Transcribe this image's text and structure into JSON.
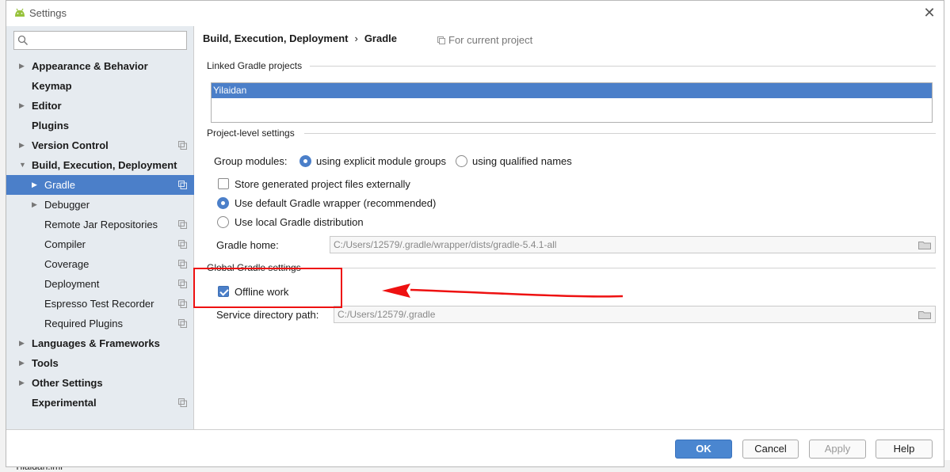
{
  "background": {
    "file_name": "Yilaidan.iml"
  },
  "window": {
    "title": "Settings",
    "close_label": "✕"
  },
  "search": {
    "placeholder": "",
    "value": ""
  },
  "tree": [
    {
      "label": "Appearance & Behavior",
      "bold": true,
      "arrow": "right",
      "indent": 0,
      "project": false
    },
    {
      "label": "Keymap",
      "bold": true,
      "arrow": "none",
      "indent": 0,
      "project": false
    },
    {
      "label": "Editor",
      "bold": true,
      "arrow": "right",
      "indent": 0,
      "project": false
    },
    {
      "label": "Plugins",
      "bold": true,
      "arrow": "none",
      "indent": 0,
      "project": false
    },
    {
      "label": "Version Control",
      "bold": true,
      "arrow": "right",
      "indent": 0,
      "project": true
    },
    {
      "label": "Build, Execution, Deployment",
      "bold": true,
      "arrow": "down",
      "indent": 0,
      "project": false
    },
    {
      "label": "Gradle",
      "bold": false,
      "arrow": "right",
      "indent": 1,
      "project": true,
      "selected": true
    },
    {
      "label": "Debugger",
      "bold": false,
      "arrow": "right",
      "indent": 1,
      "project": false
    },
    {
      "label": "Remote Jar Repositories",
      "bold": false,
      "arrow": "none",
      "indent": 1,
      "project": true
    },
    {
      "label": "Compiler",
      "bold": false,
      "arrow": "none",
      "indent": 1,
      "project": true
    },
    {
      "label": "Coverage",
      "bold": false,
      "arrow": "none",
      "indent": 1,
      "project": true
    },
    {
      "label": "Deployment",
      "bold": false,
      "arrow": "none",
      "indent": 1,
      "project": true
    },
    {
      "label": "Espresso Test Recorder",
      "bold": false,
      "arrow": "none",
      "indent": 1,
      "project": true
    },
    {
      "label": "Required Plugins",
      "bold": false,
      "arrow": "none",
      "indent": 1,
      "project": true
    },
    {
      "label": "Languages & Frameworks",
      "bold": true,
      "arrow": "right",
      "indent": 0,
      "project": false
    },
    {
      "label": "Tools",
      "bold": true,
      "arrow": "right",
      "indent": 0,
      "project": false
    },
    {
      "label": "Other Settings",
      "bold": true,
      "arrow": "right",
      "indent": 0,
      "project": false
    },
    {
      "label": "Experimental",
      "bold": true,
      "arrow": "none",
      "indent": 0,
      "project": true
    }
  ],
  "breadcrumb": {
    "parent": "Build, Execution, Deployment",
    "separator": "›",
    "current": "Gradle"
  },
  "scope_label": "For current project",
  "linked": {
    "title": "Linked Gradle projects",
    "projects": [
      "Yilaidan"
    ]
  },
  "project_level": {
    "title": "Project-level settings",
    "group_modules_label": "Group modules:",
    "option_explicit": "using explicit module groups",
    "option_qualified": "using qualified names",
    "selected_option": "explicit",
    "store_external_label": "Store generated project files externally",
    "store_external_checked": false,
    "use_wrapper_label": "Use default Gradle wrapper (recommended)",
    "use_local_label": "Use local Gradle distribution",
    "distribution": "wrapper",
    "gradle_home_label": "Gradle home:",
    "gradle_home_value": "C:/Users/12579/.gradle/wrapper/dists/gradle-5.4.1-all"
  },
  "global": {
    "title": "Global Gradle settings",
    "offline_label": "Offline work",
    "offline_checked": true,
    "service_dir_label": "Service directory path:",
    "service_dir_value": "C:/Users/12579/.gradle"
  },
  "buttons": {
    "ok": "OK",
    "cancel": "Cancel",
    "apply": "Apply",
    "help": "Help"
  }
}
